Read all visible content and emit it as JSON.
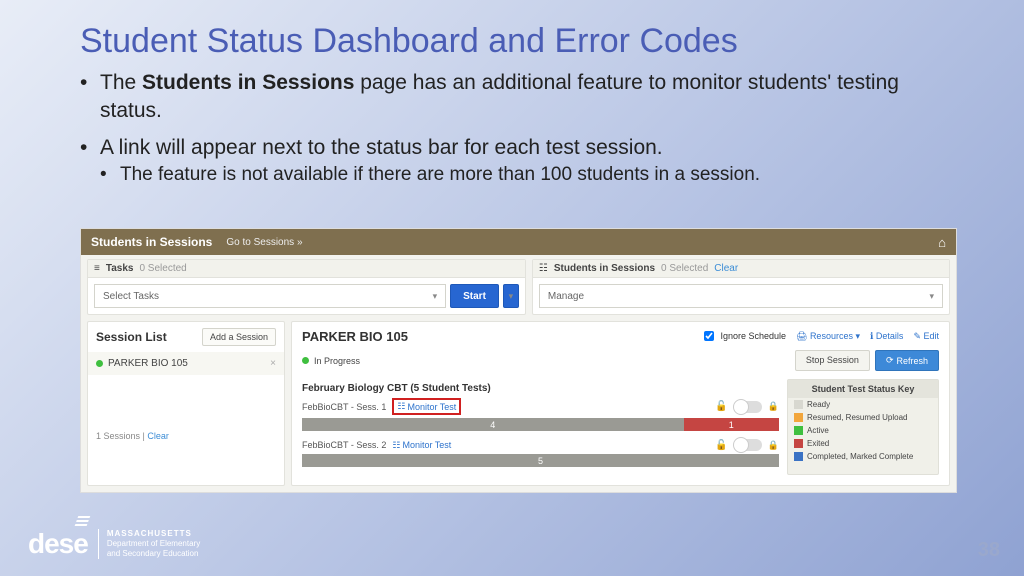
{
  "slide": {
    "title": "Student Status Dashboard and Error Codes",
    "bullet1_pre": "The ",
    "bullet1_bold": "Students in Sessions",
    "bullet1_post": " page has an additional feature to monitor students' testing status.",
    "bullet2": "A link will appear next to the status bar for each test session.",
    "sub1": "The feature is not available if there are more than 100 students in a session.",
    "page_number": "38"
  },
  "footer": {
    "logo_text": "dese",
    "state": "MASSACHUSETTS",
    "dept1": "Department of Elementary",
    "dept2": "and Secondary Education"
  },
  "shot": {
    "header_title": "Students in Sessions",
    "goto": "Go to Sessions »",
    "tasks_label": "Tasks",
    "tasks_selected": "0 Selected",
    "select_tasks": "Select Tasks",
    "start_btn": "Start",
    "sis_label": "Students in Sessions",
    "sis_selected": "0 Selected",
    "clear": "Clear",
    "manage": "Manage",
    "session_list_title": "Session List",
    "add_session": "Add a Session",
    "session_item": "PARKER BIO 105",
    "sessions_count": "1 Sessions",
    "main_title": "PARKER BIO 105",
    "in_progress": "In Progress",
    "ignore_schedule": "Ignore Schedule",
    "resources": "Resources",
    "details": "Details",
    "edit": "Edit",
    "stop_session": "Stop Session",
    "refresh": "Refresh",
    "group_title": "February Biology CBT (5 Student Tests)",
    "sess1_name": "FebBioCBT - Sess. 1",
    "sess2_name": "FebBioCBT - Sess. 2",
    "monitor_test": "Monitor Test",
    "bar1_grey": "4",
    "bar1_red": "1",
    "bar2_grey": "5",
    "key_title": "Student Test Status Key",
    "key_ready": "Ready",
    "key_resumed": "Resumed, Resumed Upload",
    "key_active": "Active",
    "key_exited": "Exited",
    "key_completed": "Completed, Marked Complete"
  }
}
